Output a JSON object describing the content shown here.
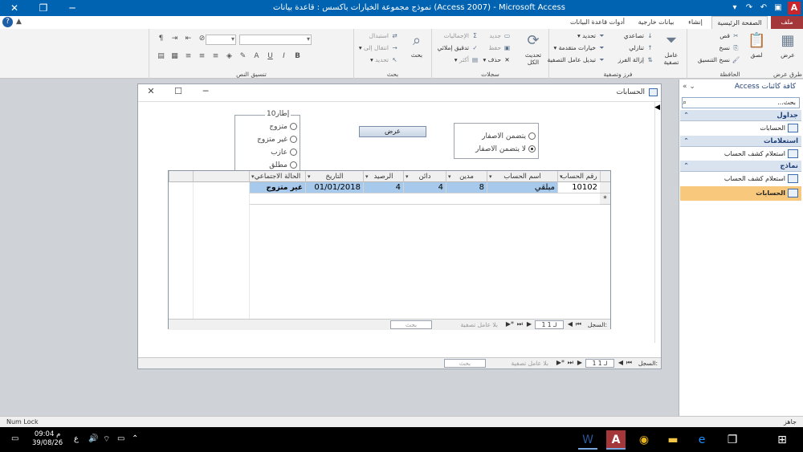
{
  "window": {
    "title": "نموذج مجموعة الخيارات باكسس : قاعدة بيانات (Access 2007) - Microsoft Access",
    "app_letter": "A"
  },
  "ribbon_tabs": [
    {
      "label": "ملف"
    },
    {
      "label": "الصفحة الرئيسية"
    },
    {
      "label": "إنشاء"
    },
    {
      "label": "بيانات خارجية"
    },
    {
      "label": "أدوات قاعدة البيانات"
    }
  ],
  "ribbon": {
    "views": {
      "label": "طرق عرض",
      "view_btn": "عرض"
    },
    "clipboard": {
      "label": "الحافظة",
      "paste": "لصق",
      "cut": "قص",
      "copy": "نسخ",
      "format_painter": "نسخ التنسيق"
    },
    "sort_filter": {
      "label": "فرز وتصفية",
      "filter": "عامل تصفية",
      "ascending": "تصاعدي",
      "descending": "تنازلي",
      "remove_sort": "إزالة الفرز",
      "selection": "تحديد",
      "advanced": "خيارات متقدمة",
      "toggle_filter": "تبديل عامل التصفية"
    },
    "records": {
      "label": "سجلات",
      "refresh_all": "تحديث الكل",
      "new": "جديد",
      "save": "حفظ",
      "delete": "حذف",
      "totals": "الإجماليات",
      "spelling": "تدقيق إملائي",
      "more": "أكثر"
    },
    "find": {
      "label": "بحث",
      "find_btn": "بحث",
      "replace": "استبدال",
      "goto": "انتقال إلى",
      "select": "تحديد"
    },
    "text_format": {
      "label": "تنسيق النص"
    }
  },
  "nav_pane": {
    "title": "كافة كائنات Access",
    "search_placeholder": "بحث...",
    "sections": [
      {
        "label": "جداول",
        "items": [
          {
            "label": "الحسابات"
          }
        ]
      },
      {
        "label": "استعلامات",
        "items": [
          {
            "label": "استعلام كشف الحساب"
          }
        ]
      },
      {
        "label": "نماذج",
        "items": [
          {
            "label": "استعلام كشف الحساب"
          },
          {
            "label": "الحسابات",
            "selected": true
          }
        ]
      }
    ]
  },
  "form": {
    "title": "الحسابات",
    "group1": {
      "caption": "إطار10",
      "options": [
        {
          "label": "متزوج",
          "checked": false
        },
        {
          "label": "غير متزوج",
          "checked": false
        },
        {
          "label": "عازب",
          "checked": false
        },
        {
          "label": "مطلق",
          "checked": false
        }
      ]
    },
    "show_button": "عرض",
    "group2": {
      "options": [
        {
          "label": "يتضمن الاصفار",
          "checked": false
        },
        {
          "label": "لا يتضمن الاصفار",
          "checked": true
        }
      ]
    },
    "grid": {
      "columns": [
        "رقم الحساب",
        "اسم الحساب",
        "مدين",
        "دائن",
        "الرصيد",
        "التاريخ",
        "الحالة الاجتماعي"
      ],
      "rows": [
        [
          "10102",
          "مبلقي",
          "8",
          "4",
          "4",
          "01/01/2018",
          "غير متزوج"
        ]
      ],
      "new_row_marker": "*"
    },
    "subform_nav": {
      "record_label": "السجل:",
      "position": "1 لـ 1",
      "filter_status": "بلا عامل تصفية",
      "search": "بحث"
    },
    "main_nav": {
      "record_label": "السجل:",
      "position": "1 لـ 1",
      "filter_status": "بلا عامل تصفية",
      "search": "بحث"
    }
  },
  "status_bar": {
    "left": "Num Lock",
    "right": "جاهز"
  },
  "taskbar": {
    "time": "09:04 م",
    "date": "39/08/26",
    "lang": "ع"
  }
}
